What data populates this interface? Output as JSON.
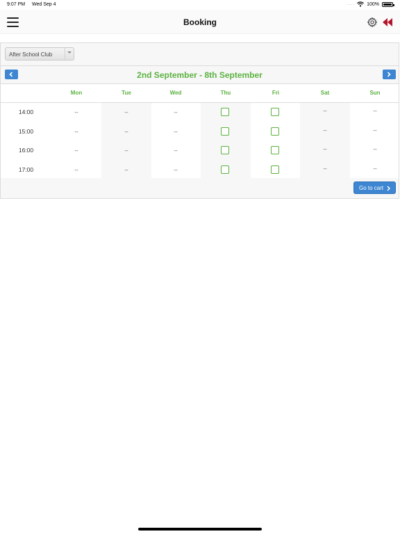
{
  "status_bar": {
    "time": "9:07 PM",
    "date": "Wed Sep 4",
    "signal": "....",
    "battery": "100%"
  },
  "nav": {
    "title": "Booking"
  },
  "selector": {
    "value": "After School Club"
  },
  "week": {
    "title": "2nd September - 8th September"
  },
  "days": [
    "Mon",
    "Tue",
    "Wed",
    "Thu",
    "Fri",
    "Sat",
    "Sun"
  ],
  "times": [
    "14:00",
    "15:00",
    "16:00",
    "17:00"
  ],
  "placeholder": "--",
  "slots": [
    [
      "--",
      "--",
      "--",
      "checkbox",
      "checkbox",
      "--",
      "--"
    ],
    [
      "--",
      "--",
      "--",
      "checkbox",
      "checkbox",
      "--",
      "--"
    ],
    [
      "--",
      "--",
      "--",
      "checkbox",
      "checkbox",
      "--",
      "--"
    ],
    [
      "--",
      "--",
      "--",
      "checkbox",
      "checkbox",
      "--",
      "--"
    ]
  ],
  "cart": {
    "label": "Go to cart"
  },
  "icons": {
    "menu": "hamburger-icon",
    "settings": "gear-icon",
    "back": "rewind-icon",
    "prev": "chevron-left-icon",
    "next": "chevron-right-icon",
    "wifi": "wifi-icon",
    "battery": "battery-icon"
  },
  "colors": {
    "accent_green": "#5bb240",
    "button_blue": "#3e86d1",
    "rewind_red": "#b3162a"
  }
}
